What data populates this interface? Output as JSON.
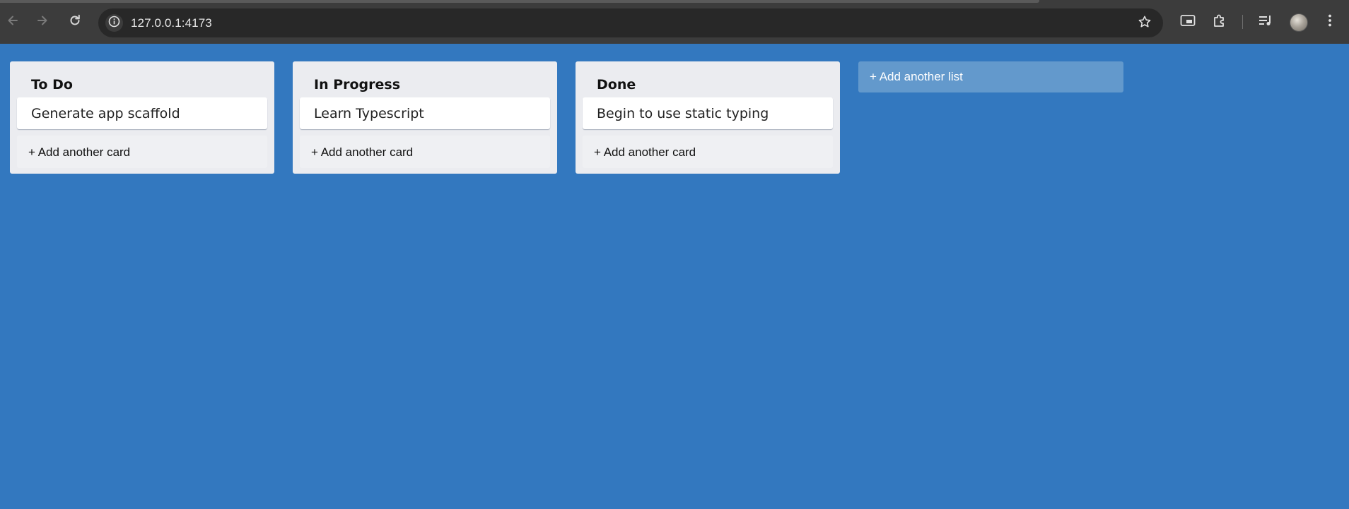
{
  "browser": {
    "url": "127.0.0.1:4173",
    "icons": {
      "back": "arrow-left-icon",
      "forward": "arrow-right-icon",
      "reload": "reload-icon",
      "site_info": "info-icon",
      "bookmark": "star-icon",
      "picture_in_picture": "pip-icon",
      "extensions": "puzzle-icon",
      "media": "media-queue-icon",
      "profile": "avatar",
      "menu": "kebab-menu-icon"
    },
    "colors": {
      "frame": "#3c3c3c",
      "omnibox": "#282828"
    }
  },
  "board": {
    "background": "#3378bf",
    "lists": [
      {
        "title": "To Do",
        "cards": [
          "Generate app scaffold"
        ],
        "add_card_label": "+ Add another card"
      },
      {
        "title": "In Progress",
        "cards": [
          "Learn Typescript"
        ],
        "add_card_label": "+ Add another card"
      },
      {
        "title": "Done",
        "cards": [
          "Begin to use static typing"
        ],
        "add_card_label": "+ Add another card"
      }
    ],
    "add_list_label": "+ Add another list"
  }
}
